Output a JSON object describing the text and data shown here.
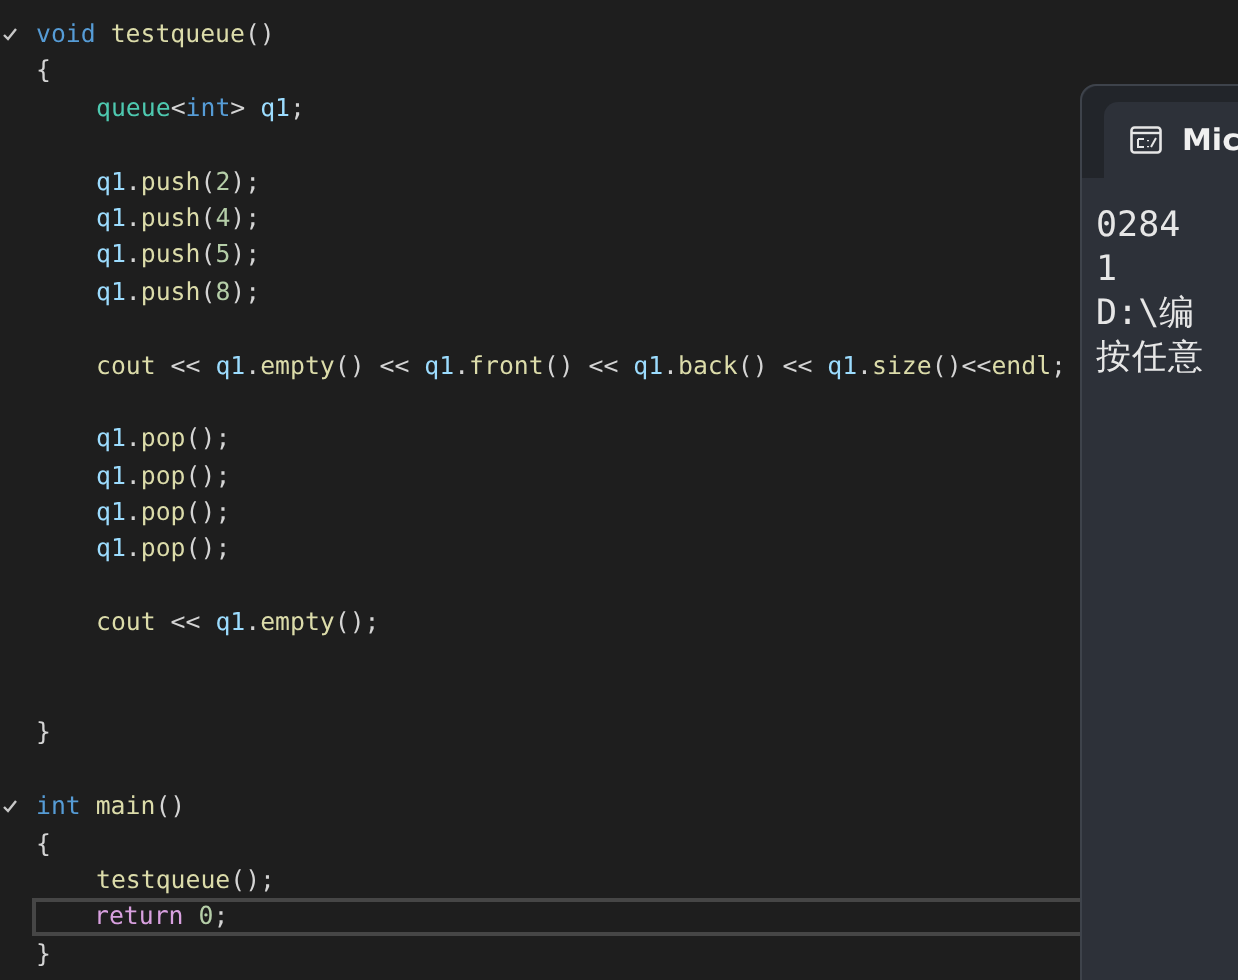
{
  "editor": {
    "lines": [
      {
        "kind": "header",
        "indent": false,
        "current": false,
        "tokens": [
          {
            "kind": "kw",
            "text": "void "
          },
          {
            "kind": "fn",
            "text": "testqueue"
          },
          {
            "kind": "plain",
            "text": "()"
          }
        ]
      },
      {
        "kind": "code",
        "indent": false,
        "current": false,
        "tokens": [
          {
            "kind": "plain",
            "text": "{"
          }
        ]
      },
      {
        "kind": "code",
        "indent": true,
        "current": false,
        "tokens": [
          {
            "kind": "type",
            "text": "queue"
          },
          {
            "kind": "plain",
            "text": "<"
          },
          {
            "kind": "kw",
            "text": "int"
          },
          {
            "kind": "plain",
            "text": "> "
          },
          {
            "kind": "var",
            "text": "q1"
          },
          {
            "kind": "plain",
            "text": ";"
          }
        ]
      },
      {
        "kind": "blank"
      },
      {
        "kind": "code",
        "indent": true,
        "current": false,
        "tokens": [
          {
            "kind": "var",
            "text": "q1"
          },
          {
            "kind": "plain",
            "text": "."
          },
          {
            "kind": "fn",
            "text": "push"
          },
          {
            "kind": "plain",
            "text": "("
          },
          {
            "kind": "num",
            "text": "2"
          },
          {
            "kind": "plain",
            "text": ");"
          }
        ]
      },
      {
        "kind": "code",
        "indent": true,
        "current": false,
        "tokens": [
          {
            "kind": "var",
            "text": "q1"
          },
          {
            "kind": "plain",
            "text": "."
          },
          {
            "kind": "fn",
            "text": "push"
          },
          {
            "kind": "plain",
            "text": "("
          },
          {
            "kind": "num",
            "text": "4"
          },
          {
            "kind": "plain",
            "text": ");"
          }
        ]
      },
      {
        "kind": "code",
        "indent": true,
        "current": false,
        "tokens": [
          {
            "kind": "var",
            "text": "q1"
          },
          {
            "kind": "plain",
            "text": "."
          },
          {
            "kind": "fn",
            "text": "push"
          },
          {
            "kind": "plain",
            "text": "("
          },
          {
            "kind": "num",
            "text": "5"
          },
          {
            "kind": "plain",
            "text": ");"
          }
        ]
      },
      {
        "kind": "code",
        "indent": true,
        "current": false,
        "tokens": [
          {
            "kind": "var",
            "text": "q1"
          },
          {
            "kind": "plain",
            "text": "."
          },
          {
            "kind": "fn",
            "text": "push"
          },
          {
            "kind": "plain",
            "text": "("
          },
          {
            "kind": "num",
            "text": "8"
          },
          {
            "kind": "plain",
            "text": ");"
          }
        ]
      },
      {
        "kind": "blank"
      },
      {
        "kind": "code",
        "indent": true,
        "current": false,
        "tokens": [
          {
            "kind": "fn",
            "text": "cout"
          },
          {
            "kind": "plain",
            "text": " << "
          },
          {
            "kind": "var",
            "text": "q1"
          },
          {
            "kind": "plain",
            "text": "."
          },
          {
            "kind": "fn",
            "text": "empty"
          },
          {
            "kind": "plain",
            "text": "() << "
          },
          {
            "kind": "var",
            "text": "q1"
          },
          {
            "kind": "plain",
            "text": "."
          },
          {
            "kind": "fn",
            "text": "front"
          },
          {
            "kind": "plain",
            "text": "() << "
          },
          {
            "kind": "var",
            "text": "q1"
          },
          {
            "kind": "plain",
            "text": "."
          },
          {
            "kind": "fn",
            "text": "back"
          },
          {
            "kind": "plain",
            "text": "() << "
          },
          {
            "kind": "var",
            "text": "q1"
          },
          {
            "kind": "plain",
            "text": "."
          },
          {
            "kind": "fn",
            "text": "size"
          },
          {
            "kind": "plain",
            "text": "()<<"
          },
          {
            "kind": "fn",
            "text": "endl"
          },
          {
            "kind": "plain",
            "text": ";"
          }
        ]
      },
      {
        "kind": "blank"
      },
      {
        "kind": "code",
        "indent": true,
        "current": false,
        "tokens": [
          {
            "kind": "var",
            "text": "q1"
          },
          {
            "kind": "plain",
            "text": "."
          },
          {
            "kind": "fn",
            "text": "pop"
          },
          {
            "kind": "plain",
            "text": "();"
          }
        ]
      },
      {
        "kind": "code",
        "indent": true,
        "current": false,
        "tokens": [
          {
            "kind": "var",
            "text": "q1"
          },
          {
            "kind": "plain",
            "text": "."
          },
          {
            "kind": "fn",
            "text": "pop"
          },
          {
            "kind": "plain",
            "text": "();"
          }
        ]
      },
      {
        "kind": "code",
        "indent": true,
        "current": false,
        "tokens": [
          {
            "kind": "var",
            "text": "q1"
          },
          {
            "kind": "plain",
            "text": "."
          },
          {
            "kind": "fn",
            "text": "pop"
          },
          {
            "kind": "plain",
            "text": "();"
          }
        ]
      },
      {
        "kind": "code",
        "indent": true,
        "current": false,
        "tokens": [
          {
            "kind": "var",
            "text": "q1"
          },
          {
            "kind": "plain",
            "text": "."
          },
          {
            "kind": "fn",
            "text": "pop"
          },
          {
            "kind": "plain",
            "text": "();"
          }
        ]
      },
      {
        "kind": "blank"
      },
      {
        "kind": "code",
        "indent": true,
        "current": false,
        "tokens": [
          {
            "kind": "fn",
            "text": "cout"
          },
          {
            "kind": "plain",
            "text": " << "
          },
          {
            "kind": "var",
            "text": "q1"
          },
          {
            "kind": "plain",
            "text": "."
          },
          {
            "kind": "fn",
            "text": "empty"
          },
          {
            "kind": "plain",
            "text": "();"
          }
        ]
      },
      {
        "kind": "blank"
      },
      {
        "kind": "blank"
      },
      {
        "kind": "code",
        "indent": false,
        "current": false,
        "tokens": [
          {
            "kind": "plain",
            "text": "}"
          }
        ]
      },
      {
        "kind": "blank"
      },
      {
        "kind": "header",
        "indent": false,
        "current": false,
        "tokens": [
          {
            "kind": "kw",
            "text": "int "
          },
          {
            "kind": "fn",
            "text": "main"
          },
          {
            "kind": "plain",
            "text": "()"
          }
        ]
      },
      {
        "kind": "code",
        "indent": false,
        "current": false,
        "tokens": [
          {
            "kind": "plain",
            "text": "{"
          }
        ]
      },
      {
        "kind": "code",
        "indent": true,
        "current": false,
        "tokens": [
          {
            "kind": "fn",
            "text": "testqueue"
          },
          {
            "kind": "plain",
            "text": "();"
          }
        ]
      },
      {
        "kind": "code",
        "indent": true,
        "current": true,
        "tokens": [
          {
            "kind": "ctrl",
            "text": "return "
          },
          {
            "kind": "num",
            "text": "0"
          },
          {
            "kind": "plain",
            "text": ";"
          }
        ]
      },
      {
        "kind": "code",
        "indent": false,
        "current": false,
        "tokens": [
          {
            "kind": "plain",
            "text": "}"
          }
        ]
      }
    ]
  },
  "console": {
    "tab": {
      "title": "Mic"
    },
    "output": [
      "0284",
      "1",
      "D:\\编",
      "按任意"
    ]
  }
}
